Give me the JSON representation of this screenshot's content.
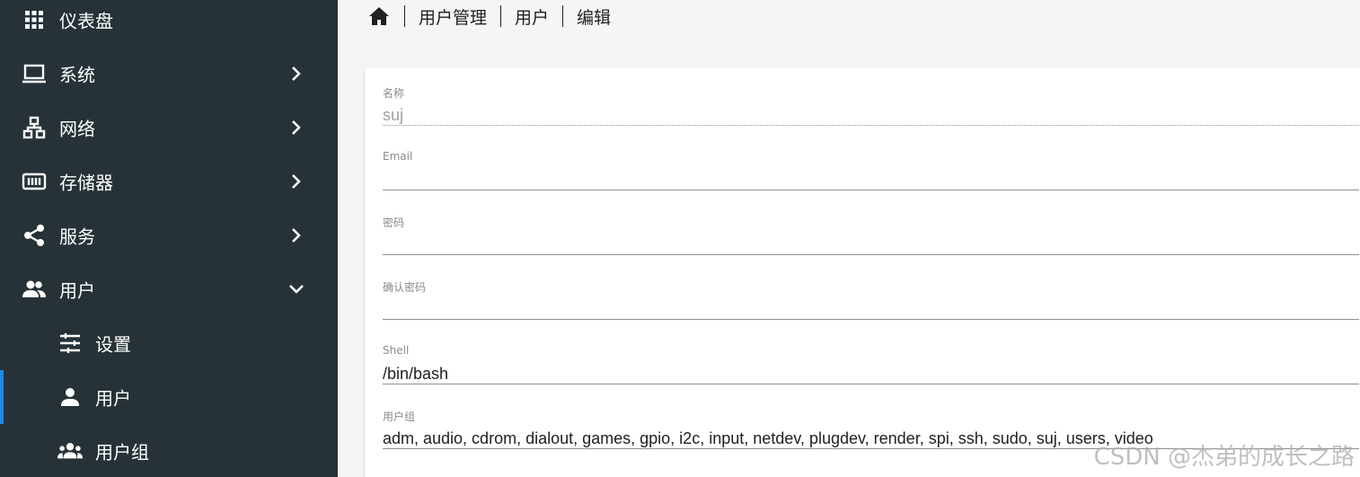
{
  "sidebar": {
    "items": [
      {
        "label": "仪表盘",
        "icon": "dashboard-grid-icon"
      },
      {
        "label": "系统",
        "icon": "laptop-icon",
        "chevron": "chevron-right-icon"
      },
      {
        "label": "网络",
        "icon": "network-icon",
        "chevron": "chevron-right-icon"
      },
      {
        "label": "存储器",
        "icon": "storage-icon",
        "chevron": "chevron-right-icon"
      },
      {
        "label": "服务",
        "icon": "share-icon",
        "chevron": "chevron-right-icon"
      },
      {
        "label": "用户",
        "icon": "users-icon",
        "chevron": "chevron-down-icon"
      }
    ],
    "subitems": [
      {
        "label": "设置",
        "icon": "tune-icon"
      },
      {
        "label": "用户",
        "icon": "user-icon",
        "active": true
      },
      {
        "label": "用户组",
        "icon": "group-icon"
      }
    ]
  },
  "breadcrumb": {
    "home_icon": "home-icon",
    "items": [
      "用户管理",
      "用户",
      "编辑"
    ]
  },
  "form": {
    "name": {
      "label": "名称",
      "value": "suj"
    },
    "email": {
      "label": "Email",
      "value": ""
    },
    "password": {
      "label": "密码",
      "value": ""
    },
    "confirm_password": {
      "label": "确认密码",
      "value": ""
    },
    "shell": {
      "label": "Shell",
      "value": "/bin/bash"
    },
    "groups": {
      "label": "用户组",
      "value": "adm, audio, cdrom, dialout, games, gpio, i2c, input, netdev, plugdev, render, spi, ssh, sudo, suj, users, video"
    }
  },
  "watermark": "CSDN @杰弟的成长之路",
  "colors": {
    "sidebar_bg": "#263238",
    "active_indicator": "#1e88e5",
    "main_bg": "#f5f5f5"
  }
}
